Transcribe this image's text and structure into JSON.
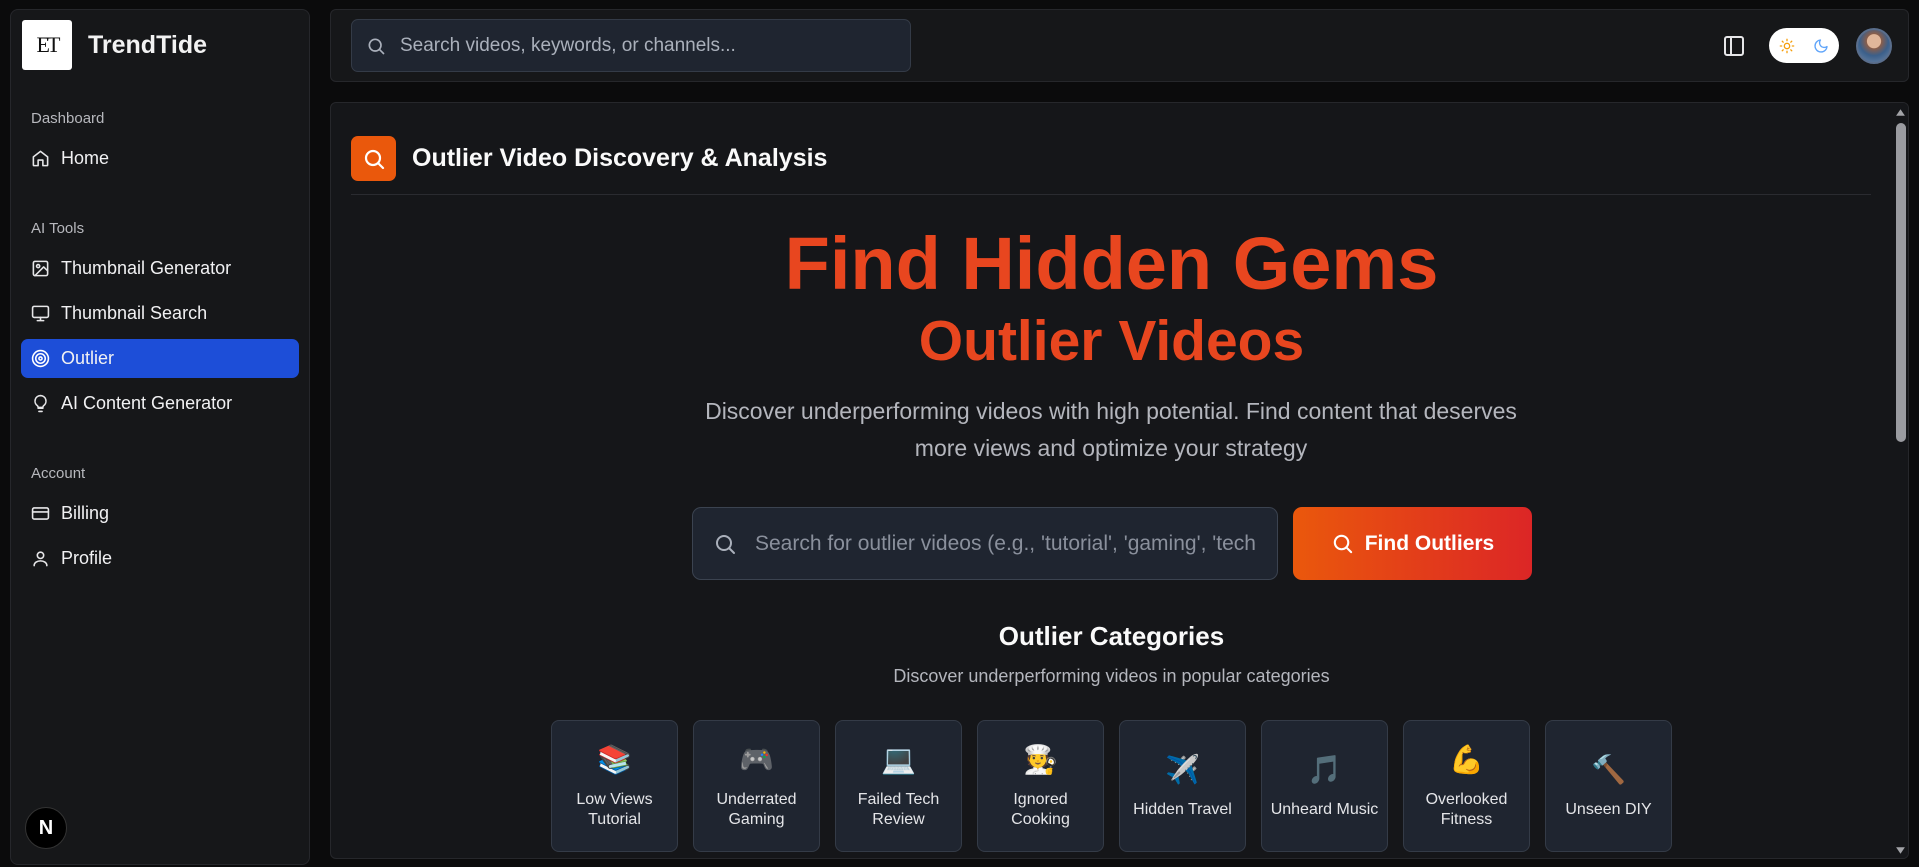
{
  "sidebar": {
    "logo_text": "ET",
    "brand_name": "TrendTide",
    "sections": [
      {
        "title": "Dashboard",
        "items": [
          {
            "label": "Home",
            "icon": "home-icon"
          }
        ]
      },
      {
        "title": "AI Tools",
        "items": [
          {
            "label": "Thumbnail Generator",
            "icon": "image-icon"
          },
          {
            "label": "Thumbnail Search",
            "icon": "monitor-icon"
          },
          {
            "label": "Outlier",
            "icon": "target-icon",
            "active": true
          },
          {
            "label": "AI Content Generator",
            "icon": "lightbulb-icon"
          }
        ]
      },
      {
        "title": "Account",
        "items": [
          {
            "label": "Billing",
            "icon": "credit-card-icon"
          },
          {
            "label": "Profile",
            "icon": "user-icon"
          }
        ]
      }
    ],
    "badge_text": "N"
  },
  "topbar": {
    "search_placeholder": "Search videos, keywords, or channels...",
    "theme": "light"
  },
  "main": {
    "title": "Outlier Video Discovery & Analysis",
    "hero_line1": "Find Hidden Gems",
    "hero_line2": "Outlier Videos",
    "description": "Discover underperforming videos with high potential. Find content that deserves more views and optimize your strategy",
    "search_placeholder": "Search for outlier videos (e.g., 'tutorial', 'gaming', 'tech reviews')",
    "button_label": "Find Outliers",
    "categories_title": "Outlier Categories",
    "categories_subtitle": "Discover underperforming videos in popular categories",
    "categories": [
      {
        "emoji": "📚",
        "label": "Low Views Tutorial"
      },
      {
        "emoji": "🎮",
        "label": "Underrated Gaming"
      },
      {
        "emoji": "💻",
        "label": "Failed Tech Review"
      },
      {
        "emoji": "🧑‍🍳",
        "label": "Ignored Cooking"
      },
      {
        "emoji": "✈️",
        "label": "Hidden Travel"
      },
      {
        "emoji": "🎵",
        "label": "Unheard Music"
      },
      {
        "emoji": "💪",
        "label": "Overlooked Fitness"
      },
      {
        "emoji": "🔨",
        "label": "Unseen DIY"
      }
    ]
  },
  "colors": {
    "accent": "#e8461f",
    "active_nav": "#1d4ed8",
    "button_gradient_start": "#ea580c",
    "button_gradient_end": "#dc2626"
  }
}
